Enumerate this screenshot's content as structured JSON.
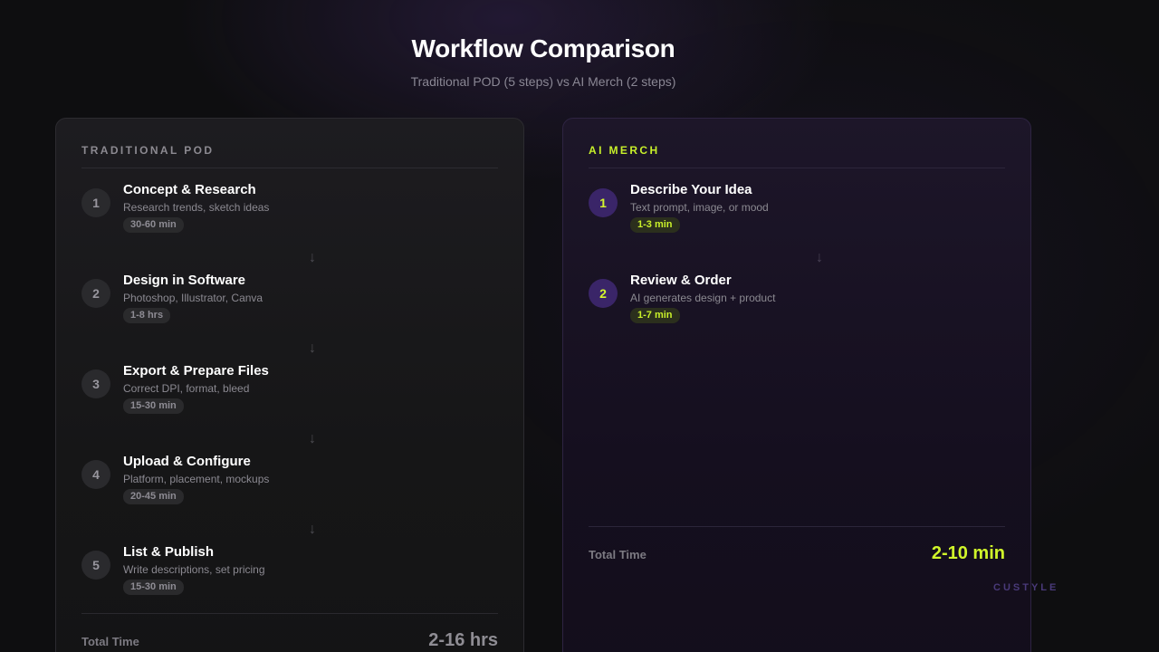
{
  "header": {
    "title": "Workflow Comparison",
    "subtitle": "Traditional POD (5 steps) vs AI Merch (2 steps)"
  },
  "traditional": {
    "heading": "TRADITIONAL POD",
    "steps": [
      {
        "num": "1",
        "title": "Concept & Research",
        "desc": "Research trends, sketch ideas",
        "time": "30-60 min"
      },
      {
        "num": "2",
        "title": "Design in Software",
        "desc": "Photoshop, Illustrator, Canva",
        "time": "1-8 hrs"
      },
      {
        "num": "3",
        "title": "Export & Prepare Files",
        "desc": "Correct DPI, format, bleed",
        "time": "15-30 min"
      },
      {
        "num": "4",
        "title": "Upload & Configure",
        "desc": "Platform, placement, mockups",
        "time": "20-45 min"
      },
      {
        "num": "5",
        "title": "List & Publish",
        "desc": "Write descriptions, set pricing",
        "time": "15-30 min"
      }
    ],
    "total_label": "Total Time",
    "total_value": "2-16 hrs"
  },
  "ai": {
    "heading": "AI MERCH",
    "steps": [
      {
        "num": "1",
        "title": "Describe Your Idea",
        "desc": "Text prompt, image, or mood",
        "time": "1-3 min"
      },
      {
        "num": "2",
        "title": "Review & Order",
        "desc": "AI generates design + product",
        "time": "1-7 min"
      }
    ],
    "total_label": "Total Time",
    "total_value": "2-10 min"
  },
  "icons": {
    "arrow": "arrow-down-icon",
    "arrow_glyph": "↓"
  },
  "colors": {
    "accent": "#c7ef2a",
    "ai_badge_bg": "#3a2568",
    "brand": "#4a3a7a"
  },
  "brand": "CUSTYLE"
}
